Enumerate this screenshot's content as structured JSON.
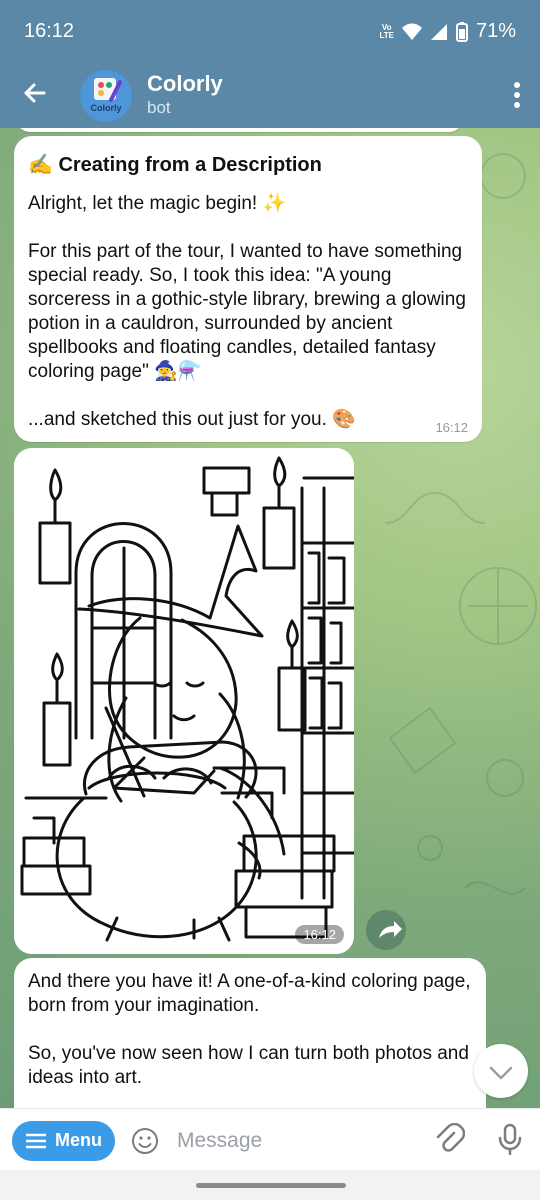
{
  "status_bar": {
    "time": "16:12",
    "volte": "Vo\nLTE",
    "battery": "71%"
  },
  "chat_header": {
    "title": "Colorly",
    "subtitle": "bot",
    "avatar_text": "Colorly"
  },
  "messages": [
    {
      "title": "✍️ Creating from a Description",
      "paragraphs": [
        "Alright, let the magic begin! ✨",
        "For this part of the tour, I wanted to have something special ready. So, I took this idea: \"A young sorceress in a gothic-style library, brewing a glowing potion in a cauldron, surrounded by ancient spellbooks and floating candles, detailed fantasy coloring page\" 🧙‍♀️⚗️",
        "...and sketched this out just for you. 🎨"
      ],
      "time": "16:12"
    },
    {
      "time": "16:12"
    },
    {
      "paragraphs": [
        "And there you have it! A one-of-a-kind coloring page, born from your imagination.",
        "So, you've now seen how I can turn both photos and ideas into art."
      ]
    }
  ],
  "composer": {
    "menu_label": "Menu",
    "placeholder": "Message"
  },
  "colors": {
    "header": "#5b88a6",
    "menu_button": "#3b9be7"
  }
}
